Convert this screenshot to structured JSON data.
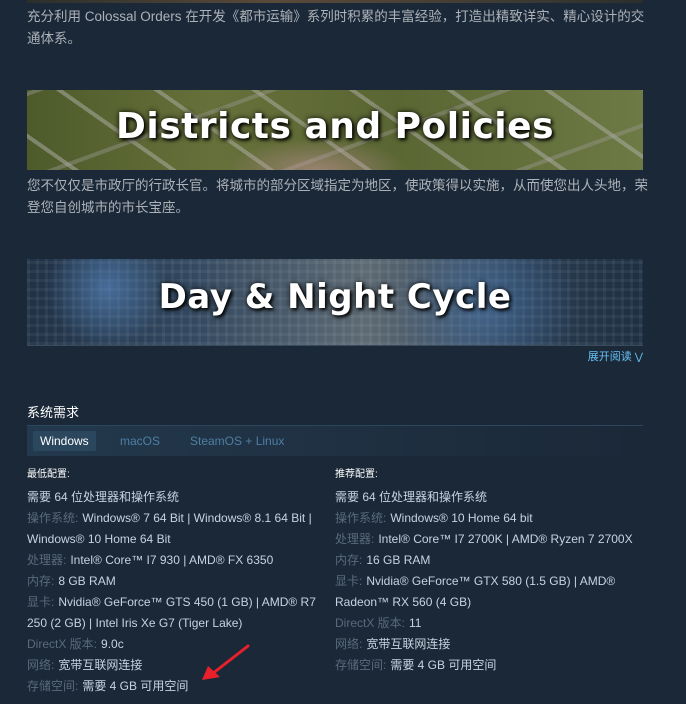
{
  "intro_text": "充分利用 Colossal Orders 在开发《都市运输》系列时积累的丰富经验，打造出精致详实、精心设计的交通体系。",
  "banner_districts": {
    "title": "Districts and Policies"
  },
  "districts_text": "您不仅仅是市政厅的行政长官。将城市的部分区域指定为地区，使政策得以实施，从而使您出人头地，荣登您自创城市的市长宝座。",
  "banner_daynight": {
    "title": "Day & Night Cycle"
  },
  "read_more": {
    "label": "展开阅读",
    "icon": "chevron-down-icon"
  },
  "sysreq": {
    "title": "系统需求",
    "tabs": [
      {
        "label": "Windows",
        "active": true
      },
      {
        "label": "macOS",
        "active": false
      },
      {
        "label": "SteamOS + Linux",
        "active": false
      }
    ],
    "minimum": {
      "header": "最低配置:",
      "os_64bit": "需要 64 位处理器和操作系统",
      "os": {
        "label": "操作系统:",
        "value": "Windows® 7 64 Bit | Windows® 8.1 64 Bit | Windows® 10 Home 64 Bit"
      },
      "cpu": {
        "label": "处理器:",
        "value": "Intel® Core™ I7 930 | AMD® FX 6350"
      },
      "ram": {
        "label": "内存:",
        "value": "8 GB RAM"
      },
      "gpu": {
        "label": "显卡:",
        "value": "Nvidia® GeForce™ GTS 450 (1 GB) | AMD® R7 250 (2 GB) | Intel Iris Xe G7 (Tiger Lake)"
      },
      "directx": {
        "label": "DirectX 版本:",
        "value": "9.0c"
      },
      "network": {
        "label": "网络:",
        "value": "宽带互联网连接"
      },
      "storage": {
        "label": "存储空间:",
        "value": "需要 4 GB 可用空间"
      }
    },
    "recommended": {
      "header": "推荐配置:",
      "os_64bit": "需要 64 位处理器和操作系统",
      "os": {
        "label": "操作系统:",
        "value": "Windows® 10 Home 64 bit"
      },
      "cpu": {
        "label": "处理器:",
        "value": "Intel® Core™ I7 2700K | AMD® Ryzen 7 2700X"
      },
      "ram": {
        "label": "内存:",
        "value": "16 GB RAM"
      },
      "gpu": {
        "label": "显卡:",
        "value": "Nvidia® GeForce™ GTX 580 (1.5 GB) | AMD® Radeon™ RX 560 (4 GB)"
      },
      "directx": {
        "label": "DirectX 版本:",
        "value": "11"
      },
      "network": {
        "label": "网络:",
        "value": "宽带互联网连接"
      },
      "storage": {
        "label": "存储空间:",
        "value": "需要 4 GB 可用空间"
      }
    }
  },
  "colors": {
    "background": "#1b2838",
    "link": "#66c0f4",
    "tab_active_bg": "#2a475e",
    "annotation_arrow": "#e8202a"
  }
}
